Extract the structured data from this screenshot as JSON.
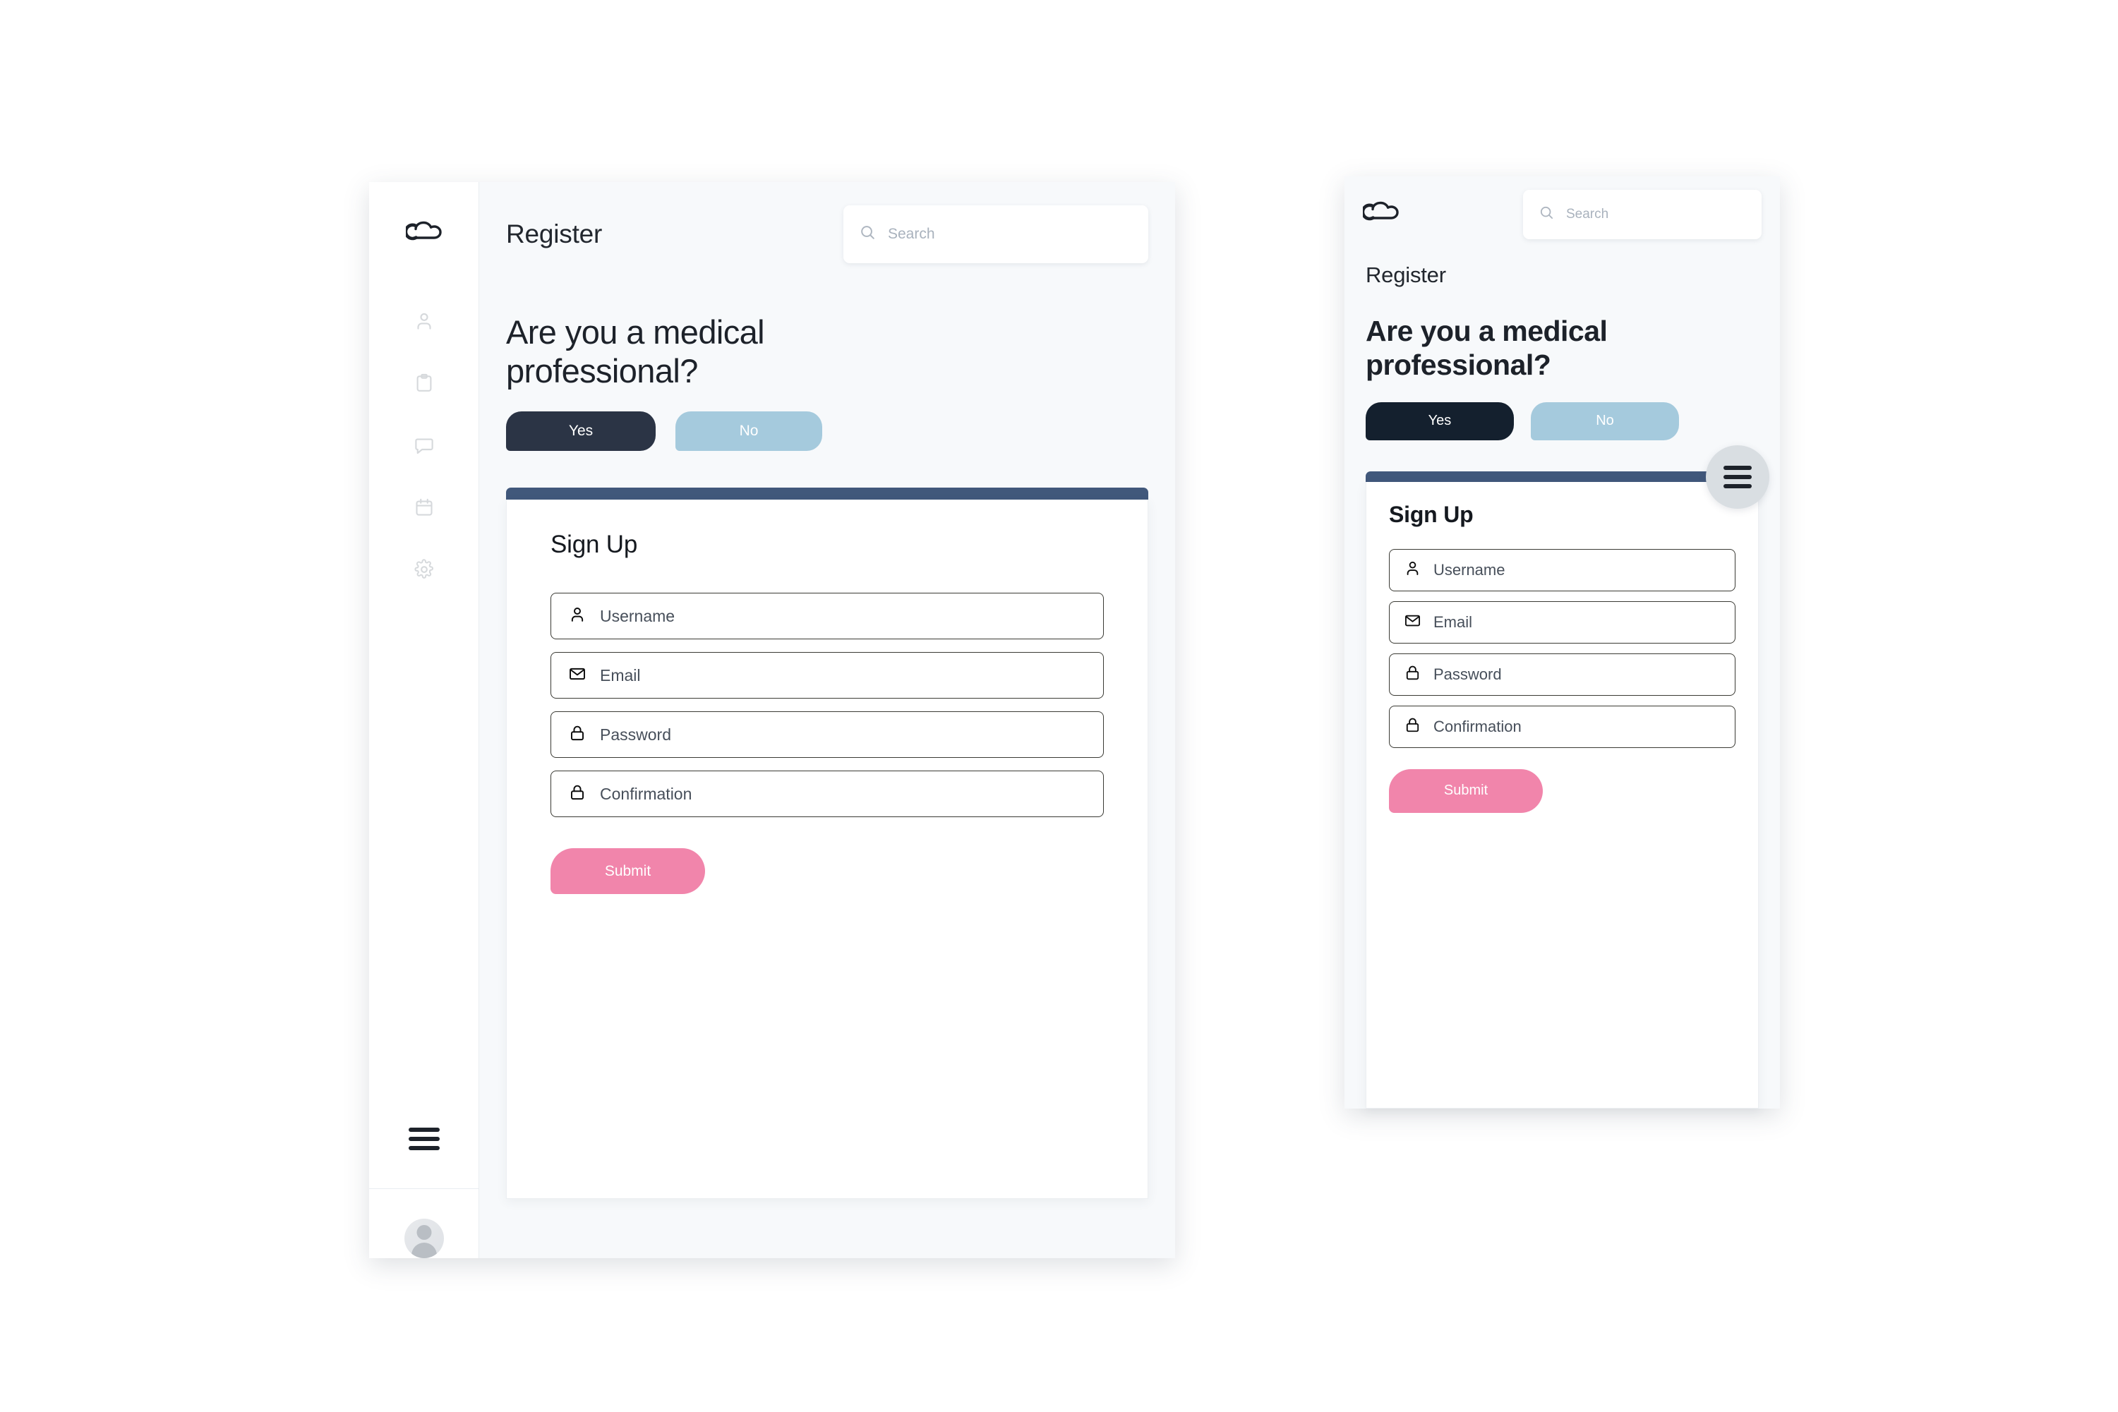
{
  "desktop": {
    "logo_icon": "cloud-logo-icon",
    "header": {
      "title": "Register",
      "search": {
        "placeholder": "Search",
        "value": "",
        "icon": "search-icon"
      }
    },
    "sidebar": {
      "items": [
        {
          "icon": "user-icon",
          "name": "profile"
        },
        {
          "icon": "clipboard-icon",
          "name": "records"
        },
        {
          "icon": "chat-icon",
          "name": "messages"
        },
        {
          "icon": "calendar-icon",
          "name": "appointments"
        },
        {
          "icon": "gear-icon",
          "name": "settings"
        }
      ],
      "menu_icon": "hamburger-icon",
      "avatar_icon": "avatar-icon"
    },
    "question": "Are you a medical professional?",
    "choices": [
      {
        "label": "Yes",
        "selected": true,
        "color": "#2b3445"
      },
      {
        "label": "No",
        "selected": false,
        "color": "#a5cadd"
      }
    ],
    "card": {
      "accent_color": "#41587b",
      "title": "Sign Up",
      "fields": [
        {
          "label": "Username",
          "icon": "user-icon",
          "value": ""
        },
        {
          "label": "Email",
          "icon": "envelope-icon",
          "value": ""
        },
        {
          "label": "Password",
          "icon": "lock-icon",
          "value": ""
        },
        {
          "label": "Confirmation",
          "icon": "lock-icon",
          "value": ""
        }
      ],
      "submit_label": "Submit",
      "submit_color": "#f185ab"
    }
  },
  "mobile": {
    "logo_icon": "cloud-logo-icon",
    "search": {
      "placeholder": "Search",
      "value": "",
      "icon": "search-icon"
    },
    "subtitle": "Register",
    "question": "Are you a medical professional?",
    "choices": [
      {
        "label": "Yes",
        "selected": true,
        "color": "#14202e"
      },
      {
        "label": "No",
        "selected": false,
        "color": "#a5cadd"
      }
    ],
    "card": {
      "accent_color": "#41587b",
      "title": "Sign Up",
      "fields": [
        {
          "label": "Username",
          "icon": "user-icon",
          "value": ""
        },
        {
          "label": "Email",
          "icon": "envelope-icon",
          "value": ""
        },
        {
          "label": "Password",
          "icon": "lock-icon",
          "value": ""
        },
        {
          "label": "Confirmation",
          "icon": "lock-icon",
          "value": ""
        }
      ],
      "submit_label": "Submit",
      "submit_color": "#f185ab"
    },
    "fab_icon": "hamburger-icon"
  }
}
